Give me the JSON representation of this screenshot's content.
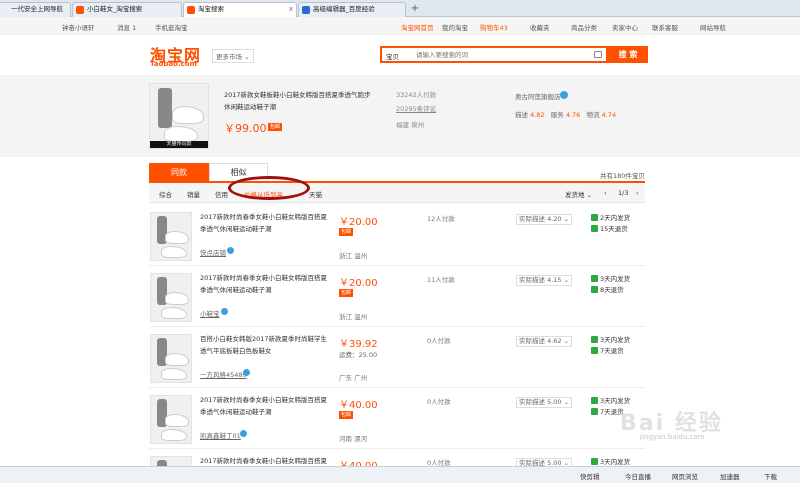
{
  "browser": {
    "tabs": [
      {
        "label": "一代安全上网导航"
      },
      {
        "label": "小白鞋女_淘宝搜索"
      },
      {
        "label": "淘宝搜索"
      },
      {
        "label": "高级编辑器_百度经验"
      }
    ],
    "new_tab": "+",
    "close": "x"
  },
  "sitenav": {
    "greeting": "钟奋小语轩",
    "messages": "消息 1",
    "mobile": "手机逛淘宝",
    "home": "淘宝网首页",
    "my_taobao": "我的淘宝",
    "cart": "购物车43",
    "favorites": "收藏夹",
    "categories": "商品分类",
    "seller": "卖家中心",
    "service": "联系客服",
    "sitemap": "网站导航"
  },
  "header": {
    "logo": "淘宝网",
    "logo_sub": "Taobao.com",
    "more_markets": "更多市场 ⌄",
    "search_scope": "宝贝",
    "search_placeholder": "请输入要搜索的词",
    "search_button": "搜 索"
  },
  "hero": {
    "title": "2017新款女鞋板鞋小白鞋女韩版百搭夏季透气跑步休闲鞋运动鞋子潮",
    "price": "￥99.00",
    "badge": "包邮",
    "paid": "33242人付款",
    "reviews": "20295条评论",
    "location": "福建 泉州",
    "shop": "奥古阿莲旗舰店",
    "rating_desc_label": "描述",
    "rating_desc": "4.82",
    "rating_service_label": "服务",
    "rating_service": "4.76",
    "rating_logistics_label": "物流",
    "rating_logistics": "4.74",
    "thumb_caption": "天猫传同款"
  },
  "tabs": {
    "same": "同款",
    "similar": "相似",
    "total": "共有180件宝贝"
  },
  "sort": {
    "items": [
      "综合",
      "销量",
      "信用",
      "价格从低到高",
      "天猫"
    ],
    "ship_to": "发货地 ⌄",
    "page": "1/3"
  },
  "rows": [
    {
      "title": "2017新款时尚春季女鞋小白鞋女韩版百搭夏季透气休闲鞋运动鞋子潮",
      "shop": "快点店铺",
      "price": "￥20.00",
      "badge": "包邮",
      "location": "浙江 温州",
      "sold": "12人付款",
      "desc": "实际描述 4.20 ⌄",
      "svc1": "2天内发货",
      "svc2": "15天退货"
    },
    {
      "title": "2017新款时尚春季女鞋小白鞋女韩版百搭夏季透气休闲鞋运动鞋子潮",
      "shop": "小鞋宝",
      "price": "￥20.00",
      "badge": "包邮",
      "location": "浙江 温州",
      "sold": "11人付款",
      "desc": "实际描述 4.15 ⌄",
      "svc1": "3天内发货",
      "svc2": "8天退货"
    },
    {
      "title": "百搭小白鞋女韩版2017新款夏季时尚鞋学生透气平底板鞋白色板鞋女",
      "shop": "一方风格45489",
      "price": "￥39.92",
      "ship": "运费：25.00",
      "location": "广东 广州",
      "sold": "0人付款",
      "desc": "实际描述 4.62 ⌄",
      "svc1": "3天内发货",
      "svc2": "7天退货"
    },
    {
      "title": "2017新款时尚春季女鞋小白鞋女韩版百搭夏季透气休闲鞋运动鞋子潮",
      "shop": "凯真鑫鞋丁01",
      "price": "￥40.00",
      "badge": "包邮",
      "location": "河南 漯河",
      "sold": "0人付款",
      "desc": "实际描述 5.00 ⌄",
      "svc1": "3天内发货",
      "svc2": "7天退货"
    },
    {
      "title": "2017新款时尚春季女鞋小白鞋女韩版百搭夏季透气休闲鞋运动鞋子潮",
      "shop": "",
      "price": "￥40.00",
      "badge": "",
      "location": "",
      "sold": "0人付款",
      "desc": "实际描述 5.00 ⌄",
      "svc1": "3天内发货",
      "svc2": ""
    }
  ],
  "statusbar": {
    "speed": "快剪辑",
    "live": "今日直播",
    "browse": "网页浏览",
    "accel": "加速器",
    "download": "下载"
  },
  "watermark": {
    "text": "Bai 经验",
    "sub": "jingyan.baidu.com"
  },
  "colors": {
    "accent": "#ff5000",
    "annotation": "#a10e0e"
  }
}
